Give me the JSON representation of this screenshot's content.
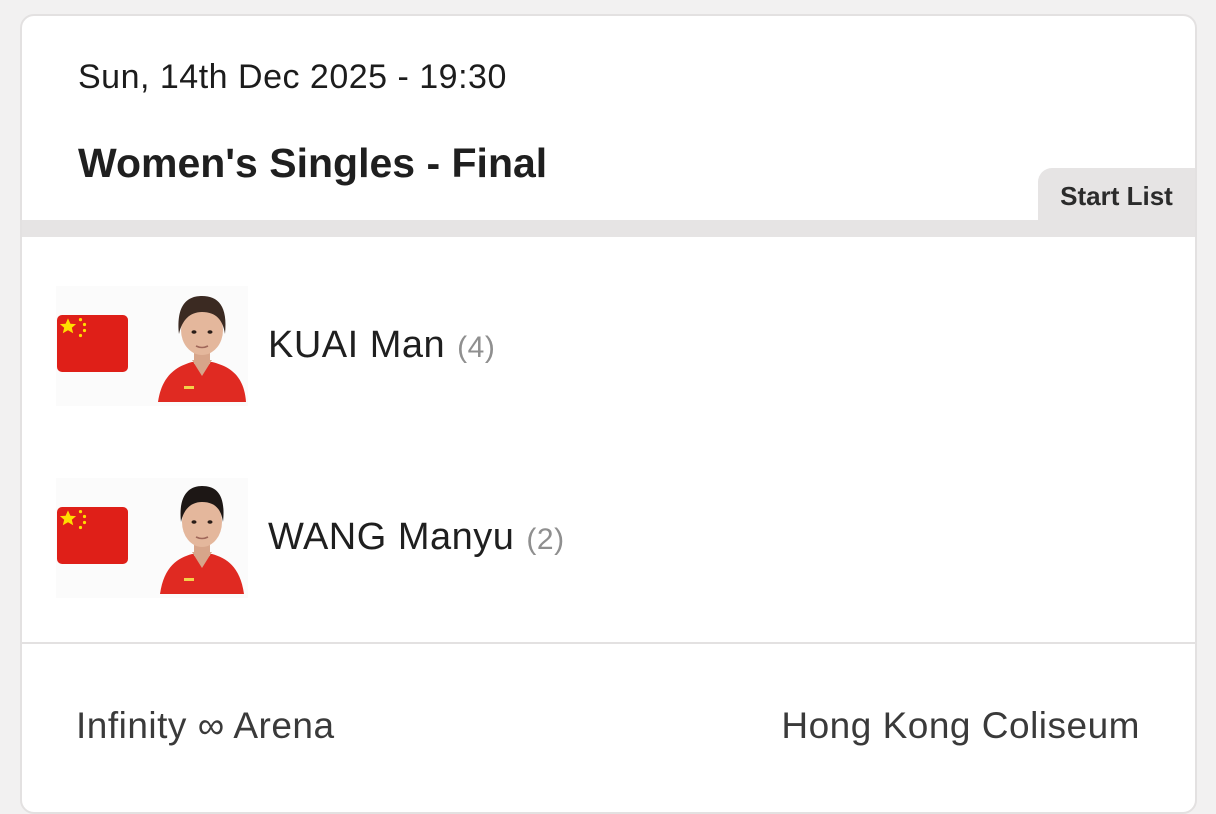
{
  "match": {
    "datetime": "Sun, 14th Dec 2025 - 19:30",
    "title": "Women's Singles - Final"
  },
  "tabs": {
    "start_list": "Start List"
  },
  "players": [
    {
      "name": "KUAI Man",
      "seed": "(4)",
      "flag": "china-flag-icon"
    },
    {
      "name": "WANG Manyu",
      "seed": "(2)",
      "flag": "china-flag-icon"
    }
  ],
  "footer": {
    "left": "Infinity ∞ Arena",
    "right": "Hong Kong Coliseum"
  },
  "colors": {
    "flag_red": "#df1f18",
    "flag_star": "#ffde00",
    "jersey_red": "#e02a22",
    "tab_grey": "#e6e4e4"
  }
}
